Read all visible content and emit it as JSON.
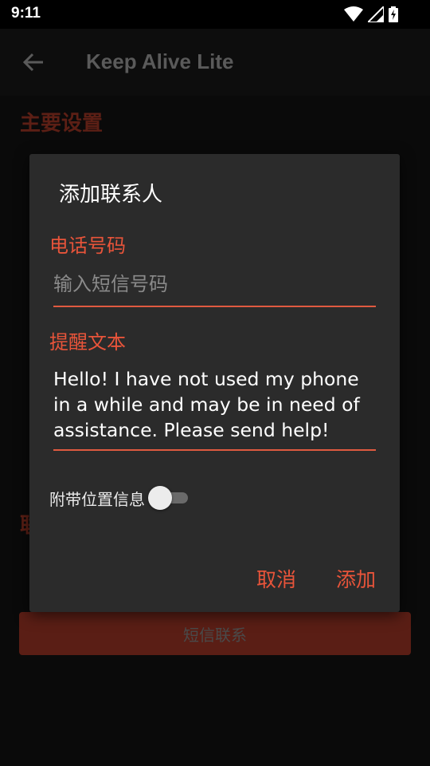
{
  "status_bar": {
    "time": "9:11",
    "icons": [
      "wifi-icon",
      "cellular-signal-icon",
      "battery-charging-icon"
    ]
  },
  "app_bar": {
    "title": "Keep Alive Lite",
    "back_icon": "arrow-back-icon"
  },
  "background": {
    "section_main_settings": "主要设置",
    "section_contacts_partial": "联",
    "sms_contact_button": "短信联系"
  },
  "dialog": {
    "title": "添加联系人",
    "phone_label": "电话号码",
    "phone_placeholder": "输入短信号码",
    "phone_value": "",
    "reminder_label": "提醒文本",
    "reminder_value": "Hello! I have not used my phone\nin a while and may be in need of\nassistance. Please send help!",
    "location_label": "附带位置信息",
    "location_enabled": false,
    "cancel_label": "取消",
    "add_label": "添加"
  },
  "colors": {
    "accent": "#e8543a",
    "dialog_bg": "#2b2b2b",
    "screen_bg": "#0a0a0a"
  }
}
